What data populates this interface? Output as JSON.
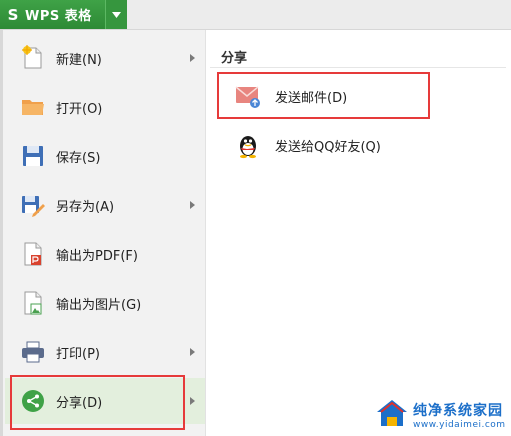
{
  "app": {
    "name": "WPS 表格",
    "logo_char": "S",
    "brand_color": "#35983d",
    "dropdown_icon": "chevron-down-icon"
  },
  "menu": {
    "items": [
      {
        "label": "新建(N)",
        "icon": "new-file-icon",
        "has_submenu": true
      },
      {
        "label": "打开(O)",
        "icon": "folder-icon",
        "has_submenu": false
      },
      {
        "label": "保存(S)",
        "icon": "save-icon",
        "has_submenu": false
      },
      {
        "label": "另存为(A)",
        "icon": "save-as-icon",
        "has_submenu": true
      },
      {
        "label": "输出为PDF(F)",
        "icon": "pdf-icon",
        "has_submenu": false
      },
      {
        "label": "输出为图片(G)",
        "icon": "image-export-icon",
        "has_submenu": false
      },
      {
        "label": "打印(P)",
        "icon": "printer-icon",
        "has_submenu": true
      },
      {
        "label": "分享(D)",
        "icon": "share-icon",
        "has_submenu": true,
        "active": true
      }
    ]
  },
  "share_panel": {
    "title": "分享",
    "items": [
      {
        "label": "发送邮件(D)",
        "icon": "mail-icon"
      },
      {
        "label": "发送给QQ好友(Q)",
        "icon": "qq-icon"
      }
    ]
  },
  "highlight_color": "#e63a3a",
  "watermark": {
    "title": "纯净系统家园",
    "url": "www.yidaimei.com"
  }
}
